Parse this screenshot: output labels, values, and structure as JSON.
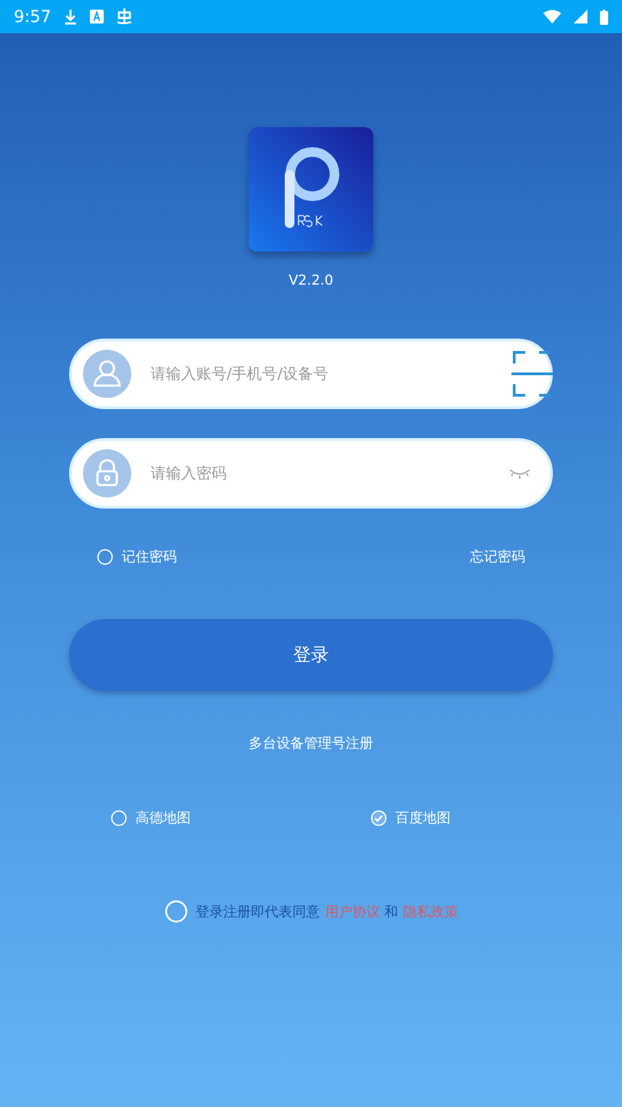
{
  "status_bar": {
    "time": "9:57"
  },
  "app": {
    "version": "V2.2.0"
  },
  "fields": [
    {
      "kind": "account",
      "placeholder": "请输入账号/手机号/设备号"
    },
    {
      "kind": "password",
      "placeholder": "请输入密码"
    }
  ],
  "remember": {
    "label": "记住密码",
    "checked": false
  },
  "forgot": "忘记密码",
  "login_button": "登录",
  "register_link": "多台设备管理号注册",
  "maps": [
    {
      "label": "高德地图",
      "selected": false
    },
    {
      "label": "百度地图",
      "selected": true
    }
  ],
  "agreement": {
    "checked": false,
    "text": "登录注册即代表同意",
    "link1": "用户协议",
    "and": "和",
    "link2": "隐私政策"
  }
}
